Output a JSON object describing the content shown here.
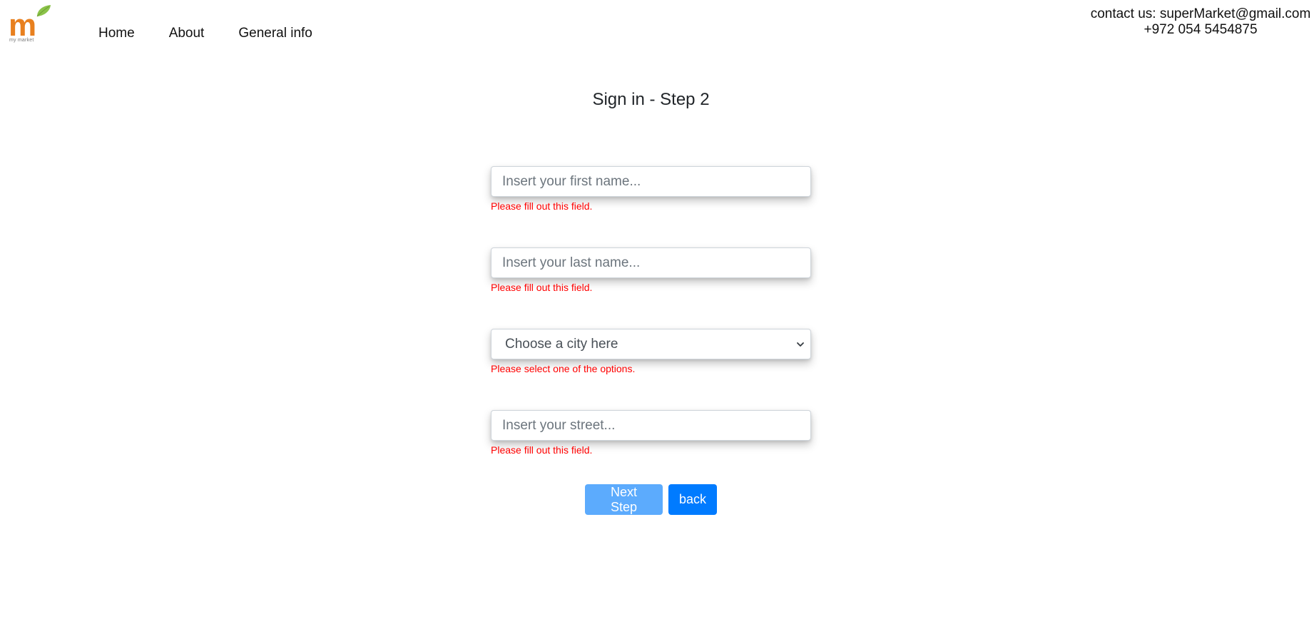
{
  "brand": {
    "logo_letter": "m",
    "logo_subtitle": "my market",
    "colors": {
      "logo_orange": "#e8801f",
      "leaf_green": "#8bc34a"
    }
  },
  "nav": {
    "items": [
      {
        "label": "Home"
      },
      {
        "label": "About"
      },
      {
        "label": "General info"
      }
    ]
  },
  "contact": {
    "email_line": "contact us: superMarket@gmail.com",
    "phone": "+972 054 5454875"
  },
  "page": {
    "title": "Sign in - Step 2"
  },
  "form": {
    "first_name": {
      "placeholder": "Insert your first name...",
      "value": "",
      "error": "Please fill out this field."
    },
    "last_name": {
      "placeholder": "Insert your last name...",
      "value": "",
      "error": "Please fill out this field."
    },
    "city": {
      "selected": "Choose a city here",
      "error": "Please select one of the options."
    },
    "street": {
      "placeholder": "Insert your street...",
      "value": "",
      "error": "Please fill out this field."
    },
    "error_color": "#ff0000"
  },
  "buttons": {
    "next_label": "Next Step",
    "back_label": "back",
    "next_color": "#5cabfd",
    "back_color": "#007bff"
  }
}
